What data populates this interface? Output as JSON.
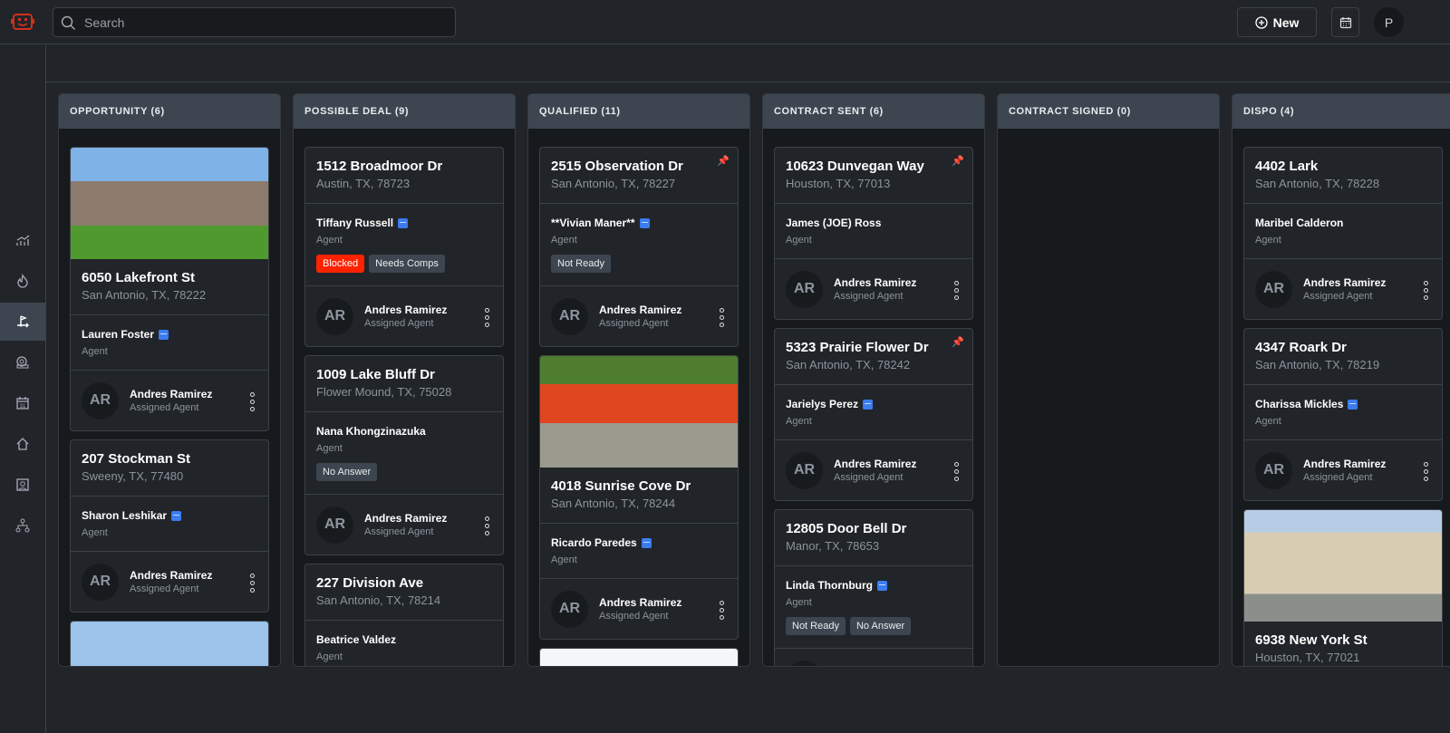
{
  "header": {
    "search_placeholder": "Search",
    "new_label": "New",
    "user_initial": "P"
  },
  "sidebar": {
    "items": [
      "analytics",
      "hot-leads",
      "pipeline",
      "alerts",
      "calendar",
      "properties",
      "contacts",
      "organization"
    ],
    "active": 2
  },
  "colors": {
    "accent": "#3b7cf0",
    "blocked": "#ff2200",
    "pin": "#f0c419",
    "logo": "#d0301c"
  },
  "columns": [
    {
      "title": "OPPORTUNITY (6)",
      "cards": [
        {
          "image": "house-brick",
          "address": "6050 Lakefront St",
          "city": "San Antonio, TX, 78222",
          "contact": "Lauren Foster",
          "cal": true,
          "role": "Agent",
          "agent": "Andres Ramirez",
          "agent_role": "Assigned Agent",
          "initials": "AR"
        },
        {
          "address": "207 Stockman St",
          "city": "Sweeny, TX, 77480",
          "contact": "Sharon Leshikar",
          "cal": true,
          "role": "Agent",
          "agent": "Andres Ramirez",
          "agent_role": "Assigned Agent",
          "initials": "AR"
        },
        {
          "image": "house-trees"
        }
      ]
    },
    {
      "title": "POSSIBLE DEAL (9)",
      "cards": [
        {
          "address": "1512 Broadmoor Dr",
          "city": "Austin, TX, 78723",
          "contact": "Tiffany Russell",
          "cal": true,
          "role": "Agent",
          "tags": [
            {
              "label": "Blocked",
              "type": "red"
            },
            {
              "label": "Needs Comps"
            }
          ],
          "agent": "Andres Ramirez",
          "agent_role": "Assigned Agent",
          "initials": "AR"
        },
        {
          "address": "1009 Lake Bluff Dr",
          "city": "Flower Mound, TX, 75028",
          "contact": "Nana Khongzinazuka",
          "role": "Agent",
          "tags": [
            {
              "label": "No Answer"
            }
          ],
          "agent": "Andres Ramirez",
          "agent_role": "Assigned Agent",
          "initials": "AR"
        },
        {
          "address": "227 Division Ave",
          "city": "San Antonio, TX, 78214",
          "contact": "Beatrice Valdez",
          "role": "Agent"
        }
      ]
    },
    {
      "title": "QUALIFIED (11)",
      "cards": [
        {
          "pinned": true,
          "address": "2515 Observation Dr",
          "city": "San Antonio, TX, 78227",
          "contact": "**Vivian Maner**",
          "cal": true,
          "role": "Agent",
          "tags": [
            {
              "label": "Not Ready"
            }
          ],
          "agent": "Andres Ramirez",
          "agent_role": "Assigned Agent",
          "initials": "AR"
        },
        {
          "image": "house-orange",
          "address": "4018 Sunrise Cove Dr",
          "city": "San Antonio, TX, 78244",
          "contact": "Ricardo Paredes",
          "cal": true,
          "role": "Agent",
          "agent": "Andres Ramirez",
          "agent_role": "Assigned Agent",
          "initials": "AR"
        },
        {
          "image": "house-sky"
        }
      ]
    },
    {
      "title": "CONTRACT SENT (6)",
      "cards": [
        {
          "pinned": true,
          "address": "10623 Dunvegan Way",
          "city": "Houston, TX, 77013",
          "contact": "James (JOE) Ross",
          "role": "Agent",
          "agent": "Andres Ramirez",
          "agent_role": "Assigned Agent",
          "initials": "AR"
        },
        {
          "pinned": true,
          "address": "5323 Prairie Flower Dr",
          "city": "San Antonio, TX, 78242",
          "contact": "Jarielys Perez",
          "cal": true,
          "role": "Agent",
          "agent": "Andres Ramirez",
          "agent_role": "Assigned Agent",
          "initials": "AR"
        },
        {
          "address": "12805 Door Bell Dr",
          "city": "Manor, TX, 78653",
          "contact": "Linda Thornburg",
          "cal": true,
          "role": "Agent",
          "tags": [
            {
              "label": "Not Ready"
            },
            {
              "label": "No Answer"
            }
          ],
          "agent": "Andres Ramirez",
          "agent_role": "Assigned Agent",
          "initials": "AR"
        }
      ]
    },
    {
      "title": "CONTRACT SIGNED (0)",
      "cards": []
    },
    {
      "title": "DISPO (4)",
      "cards": [
        {
          "address": "4402 Lark",
          "city": "San Antonio, TX, 78228",
          "contact": "Maribel Calderon",
          "role": "Agent",
          "agent": "Andres Ramirez",
          "agent_role": "Assigned Agent",
          "initials": "AR"
        },
        {
          "address": "4347 Roark Dr",
          "city": "San Antonio, TX, 78219",
          "contact": "Charissa Mickles",
          "cal": true,
          "role": "Agent",
          "agent": "Andres Ramirez",
          "agent_role": "Assigned Agent",
          "initials": "AR"
        },
        {
          "image": "house-townhome",
          "address": "6938 New York St",
          "city": "Houston, TX, 77021"
        }
      ]
    }
  ]
}
